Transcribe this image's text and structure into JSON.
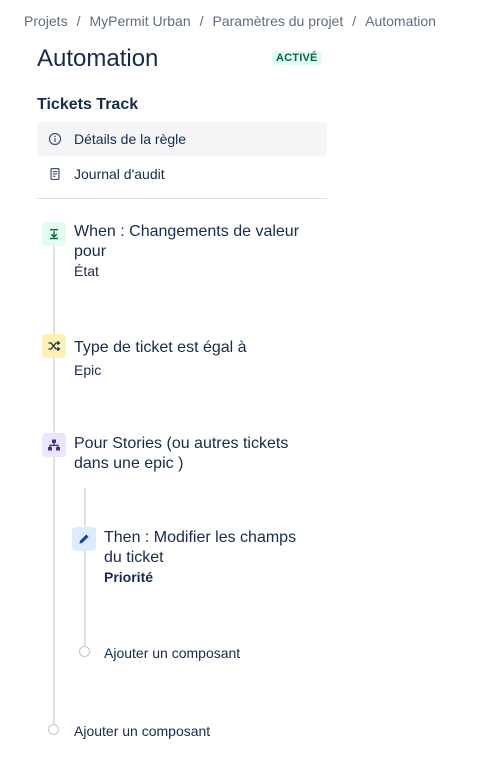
{
  "breadcrumb": {
    "items": [
      "Projets",
      "MyPermit Urban",
      "Paramètres du projet",
      "Automation"
    ],
    "separator": "/"
  },
  "page": {
    "title": "Automation",
    "status": "ACTIVÉ"
  },
  "rule": {
    "name": "Tickets Track",
    "nav": [
      {
        "label": "Détails de la règle",
        "icon": "info-icon",
        "selected": true
      },
      {
        "label": "Journal d'audit",
        "icon": "audit-log-icon",
        "selected": false
      }
    ]
  },
  "components": {
    "trigger": {
      "title_line1": "When : Changements de valeur",
      "title_line2": "pour",
      "detail": "État",
      "icon": "trigger-icon"
    },
    "condition": {
      "title": "Type de ticket est égal à",
      "detail": "Epic",
      "icon": "shuffle-icon"
    },
    "branch": {
      "title_line1": "Pour Stories (ou autres tickets",
      "title_line2": "dans une epic )",
      "icon": "branch-icon"
    },
    "action": {
      "title_line1": "Then : Modifier les champs",
      "title_line2": "du ticket",
      "detail": "Priorité",
      "icon": "pencil-icon"
    },
    "add_nested": "Ajouter un composant",
    "add_root": "Ajouter un composant"
  },
  "colors": {
    "trigger_bg": "#e3fcef",
    "condition_bg": "#fff0b3",
    "branch_bg": "#eae6ff",
    "action_bg": "#deebff",
    "status_bg": "#e3fcef",
    "status_text": "#006644"
  }
}
